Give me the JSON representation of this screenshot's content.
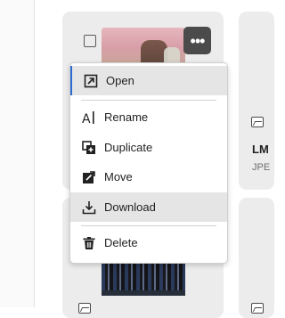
{
  "menu": {
    "items": [
      {
        "label": "Open",
        "icon": "open-external-icon"
      },
      {
        "label": "Rename",
        "icon": "rename-icon"
      },
      {
        "label": "Duplicate",
        "icon": "duplicate-icon"
      },
      {
        "label": "Move",
        "icon": "move-icon"
      },
      {
        "label": "Download",
        "icon": "download-icon"
      },
      {
        "label": "Delete",
        "icon": "trash-icon"
      }
    ],
    "highlighted": [
      "Open",
      "Download"
    ]
  },
  "cards": {
    "right_card": {
      "title": "LM",
      "type": "JPE"
    }
  },
  "colors": {
    "accent": "#2d6ad1",
    "card_bg": "#ececec",
    "more_button_bg": "#4b4b4b",
    "highlight_bg": "#e5e5e5"
  }
}
